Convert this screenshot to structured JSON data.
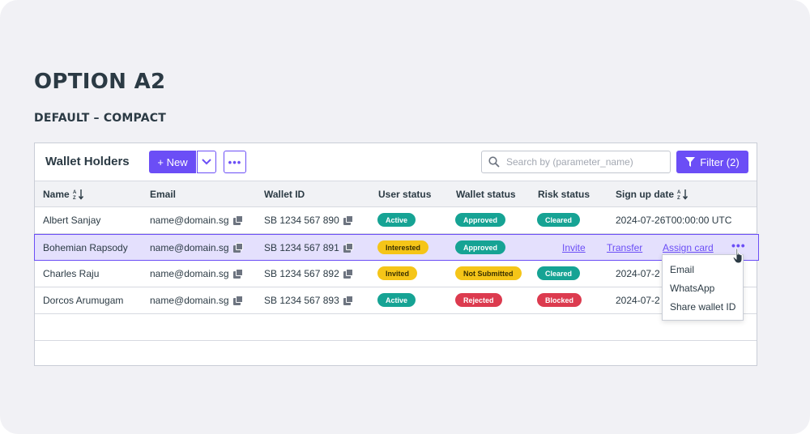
{
  "heading": "OPTION A2",
  "subheading": "DEFAULT – COMPACT",
  "panel": {
    "title": "Wallet Holders",
    "new_label": "+ New",
    "more_label": "•••",
    "search_placeholder": "Search by (parameter_name)",
    "filter_label": "Filter (2)"
  },
  "columns": {
    "name": "Name",
    "email": "Email",
    "wallet_id": "Wallet ID",
    "user_status": "User status",
    "wallet_status": "Wallet status",
    "risk_status": "Risk status",
    "signup": "Sign up date"
  },
  "rows": [
    {
      "name": "Albert Sanjay",
      "email": "name@domain.sg",
      "wallet_id": "SB 1234 567 890",
      "user_status": "Active",
      "wallet_status": "Approved",
      "risk_status": "Cleared",
      "signup": "2024-07-26T00:00:00 UTC"
    },
    {
      "name": "Bohemian Rapsody",
      "email": "name@domain.sg",
      "wallet_id": "SB 1234 567 891",
      "user_status": "Interested",
      "wallet_status": "Approved"
    },
    {
      "name": "Charles Raju",
      "email": "name@domain.sg",
      "wallet_id": "SB 1234 567 892",
      "user_status": "Invited",
      "wallet_status": "Not Submitted",
      "risk_status": "Cleared",
      "signup": "2024-07-2"
    },
    {
      "name": "Dorcos Arumugam",
      "email": "name@domain.sg",
      "wallet_id": "SB 1234 567 893",
      "user_status": "Active",
      "wallet_status": "Rejected",
      "risk_status": "Blocked",
      "signup": "2024-07-2"
    }
  ],
  "row_actions": {
    "invite": "Invite",
    "transfer": "Transfer",
    "assign_card": "Assign card",
    "more": "•••"
  },
  "menu": [
    "Email",
    "WhatsApp",
    "Share wallet ID"
  ],
  "colors": {
    "accent": "#6b4ef6",
    "status_green": "#16a394",
    "status_yellow": "#f5c518",
    "status_red": "#dc3b4f"
  }
}
